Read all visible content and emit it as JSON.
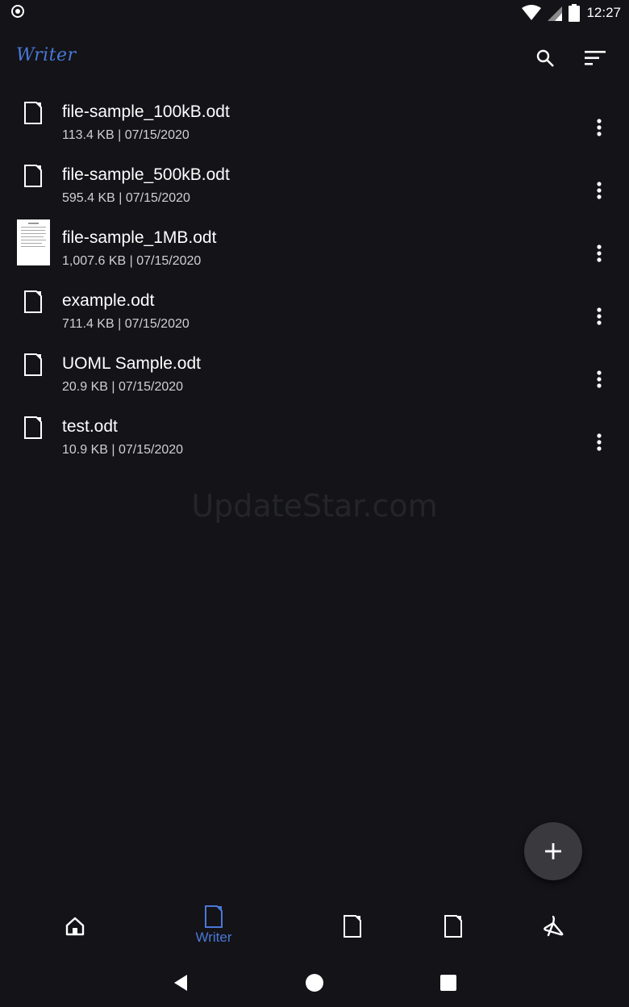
{
  "status_bar": {
    "time": "12:27"
  },
  "app_bar": {
    "title": "Writer"
  },
  "files": [
    {
      "name": "file-sample_100kB.odt",
      "meta": "113.4 KB | 07/15/2020"
    },
    {
      "name": "file-sample_500kB.odt",
      "meta": "595.4 KB | 07/15/2020"
    },
    {
      "name": "file-sample_1MB.odt",
      "meta": "1,007.6 KB | 07/15/2020"
    },
    {
      "name": "example.odt",
      "meta": "711.4 KB | 07/15/2020"
    },
    {
      "name": "UOML Sample.odt",
      "meta": "20.9 KB | 07/15/2020"
    },
    {
      "name": "test.odt",
      "meta": "10.9 KB | 07/15/2020"
    }
  ],
  "watermark": "UpdateStar.com",
  "bottom_nav": {
    "writer_label": "Writer"
  },
  "colors": {
    "accent": "#4a78d6",
    "background": "#131318",
    "fab": "#3a3a3e"
  }
}
